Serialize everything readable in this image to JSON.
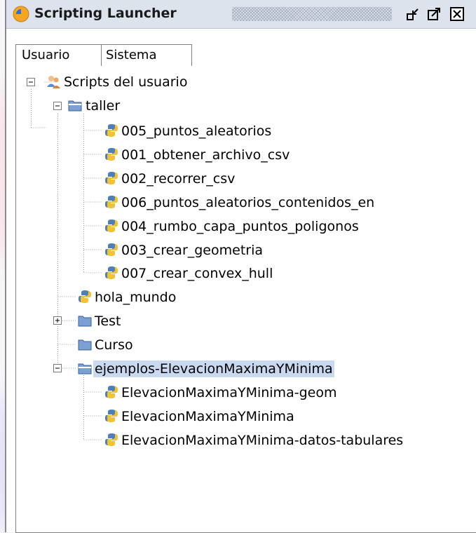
{
  "window": {
    "title": "Scripting Launcher"
  },
  "tabs": [
    {
      "label": "Usuario",
      "active": true
    },
    {
      "label": "Sistema",
      "active": false
    }
  ],
  "tree": {
    "root": {
      "label": "Scripts del usuario",
      "expanded": true,
      "icon": "users-icon"
    },
    "taller": {
      "label": "taller",
      "expanded": true,
      "icon": "folder-open-icon",
      "items": [
        {
          "label": "005_puntos_aleatorios"
        },
        {
          "label": "001_obtener_archivo_csv"
        },
        {
          "label": "002_recorrer_csv"
        },
        {
          "label": "006_puntos_aleatorios_contenidos_en"
        },
        {
          "label": "004_rumbo_capa_puntos_poligonos"
        },
        {
          "label": "003_crear_geometria"
        },
        {
          "label": "007_crear_convex_hull"
        }
      ]
    },
    "hola_mundo": {
      "label": "hola_mundo"
    },
    "test": {
      "label": "Test",
      "expanded": false
    },
    "curso": {
      "label": "Curso"
    },
    "ejemplos": {
      "label": "ejemplos-ElevacionMaximaYMinima",
      "expanded": true,
      "selected": true,
      "items": [
        {
          "label": "ElevacionMaximaYMinima-geom"
        },
        {
          "label": "ElevacionMaximaYMinima"
        },
        {
          "label": "ElevacionMaximaYMinima-datos-tabulares"
        }
      ]
    }
  },
  "colors": {
    "selection": "#c9daf0",
    "titlebar": "#dde3ec",
    "folder": "#7ba1d4"
  }
}
